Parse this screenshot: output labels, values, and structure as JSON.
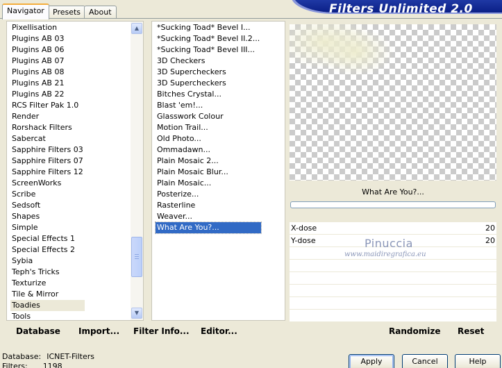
{
  "app": {
    "logo_text": "Filters Unlimited 2.0"
  },
  "tabs": [
    {
      "label": "Navigator",
      "active": true
    },
    {
      "label": "Presets",
      "active": false
    },
    {
      "label": "About",
      "active": false
    }
  ],
  "categories": {
    "items": [
      "Pixellisation",
      "Plugins AB 03",
      "Plugins AB 06",
      "Plugins AB 07",
      "Plugins AB 08",
      "Plugins AB 21",
      "Plugins AB 22",
      "RCS Filter Pak 1.0",
      "Render",
      "Rorshack Filters",
      "Sabercat",
      "Sapphire Filters 03",
      "Sapphire Filters 07",
      "Sapphire Filters 12",
      "ScreenWorks",
      "Scribe",
      "Sedsoft",
      "Shapes",
      "Simple",
      "Special Effects 1",
      "Special Effects 2",
      "Sybia",
      "Teph's Tricks",
      "Texturize",
      "Tile & Mirror",
      "Toadies",
      "Tools"
    ],
    "selected": "Toadies"
  },
  "filters": {
    "items": [
      "*Sucking Toad*  Bevel I...",
      "*Sucking Toad*  Bevel II.2...",
      "*Sucking Toad*  Bevel III...",
      "3D Checkers",
      "3D Supercheckers",
      "3D Supercheckers",
      "Bitches Crystal...",
      "Blast 'em!...",
      "Glasswork Colour",
      "Motion Trail...",
      "Old Photo...",
      "Ommadawn...",
      "Plain Mosaic 2...",
      "Plain Mosaic Blur...",
      "Plain Mosaic...",
      "Posterize...",
      "Rasterline",
      "Weaver...",
      "What Are You?..."
    ],
    "selected": "What Are You?..."
  },
  "preview": {
    "filter_name": "What Are You?..."
  },
  "params": [
    {
      "label": "X-dose",
      "value": "20"
    },
    {
      "label": "Y-dose",
      "value": "20"
    },
    {
      "label": "",
      "value": ""
    },
    {
      "label": "",
      "value": ""
    },
    {
      "label": "",
      "value": ""
    },
    {
      "label": "",
      "value": ""
    },
    {
      "label": "",
      "value": ""
    },
    {
      "label": "",
      "value": ""
    }
  ],
  "watermark": {
    "name": "Pinuccia",
    "site": "www.maidiregrafica.eu"
  },
  "toolbar": {
    "database": "Database",
    "import": "Import...",
    "filter_info": "Filter Info...",
    "editor": "Editor...",
    "randomize": "Randomize",
    "reset": "Reset"
  },
  "status": {
    "database_label": "Database:",
    "database_value": "ICNET-Filters",
    "filters_label": "Filters:",
    "filters_value": "1198"
  },
  "buttons": {
    "apply": "Apply",
    "cancel": "Cancel",
    "help": "Help"
  }
}
